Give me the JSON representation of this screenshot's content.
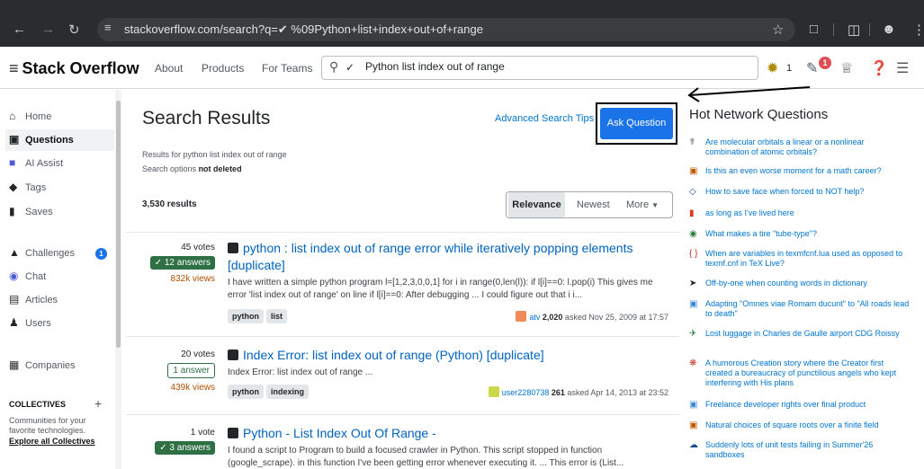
{
  "browser": {
    "url": "stackoverflow.com/search?q=✔ %09Python+list+index+out+of+range"
  },
  "topbar": {
    "logo": "Stack Overflow",
    "nav": [
      "About",
      "Products",
      "For Teams"
    ],
    "search_value": "Python list index out of range",
    "reputation": "1",
    "inbox_badge": "1"
  },
  "sidebar": {
    "items": [
      {
        "label": "Home",
        "icon": "home-icon"
      },
      {
        "label": "Questions",
        "icon": "questions-icon"
      },
      {
        "label": "AI Assist",
        "icon": "ai-assist-icon"
      },
      {
        "label": "Tags",
        "icon": "tag-icon"
      },
      {
        "label": "Saves",
        "icon": "bookmark-icon"
      },
      {
        "label": "Challenges",
        "icon": "challenges-icon"
      },
      {
        "label": "Chat",
        "icon": "chat-icon"
      },
      {
        "label": "Articles",
        "icon": "articles-icon"
      },
      {
        "label": "Users",
        "icon": "users-icon"
      },
      {
        "label": "Companies",
        "icon": "companies-icon"
      }
    ],
    "challenges_badge": "1",
    "collectives_title": "COLLECTIVES",
    "collectives_desc": "Communities for your favorite technologies.",
    "collectives_link": "Explore all Collectives"
  },
  "main": {
    "title": "Search Results",
    "advanced_tips": "Advanced Search Tips",
    "ask_button": "Ask Question",
    "results_for": "Results for python list index out of range",
    "search_options_label": "Search options",
    "search_options_value": "not deleted",
    "results_count": "3,530 results",
    "filters": {
      "relevance": "Relevance",
      "newest": "Newest",
      "more": "More"
    },
    "questions": [
      {
        "votes": "45 votes",
        "answers": "✓ 12 answers",
        "views": "832k views",
        "title": "python : list index out of range error while iteratively popping elements [duplicate]",
        "excerpt": "I have written a simple python program l=[1,2,3,0,0,1] for i in range(0,len(l)): if l[i]==0: l.pop(i) This gives me error 'list index out of range' on line if l[i]==0: After debugging ... I could figure out that i i...",
        "tags": [
          "python",
          "list"
        ],
        "user": "atv",
        "rep": "2,020",
        "asked": "asked Nov 25, 2009 at 17:57"
      },
      {
        "votes": "20 votes",
        "answers": "1 answer",
        "views": "439k views",
        "title": "Index Error: list index out of range (Python) [duplicate]",
        "excerpt": "Index Error: list index out of range ...",
        "tags": [
          "python",
          "indexing"
        ],
        "user": "user2280738",
        "rep": "261",
        "asked": "asked Apr 14, 2013 at 23:52"
      },
      {
        "votes": "1 vote",
        "answers": "✓ 3 answers",
        "views": "",
        "title": "Python - List Index Out Of Range -",
        "excerpt": "I found a script to Program to build a focused crawler in Python. This script stopped in function (google_scrape). in this function I've been getting error whenever executing it. ... This error is (List..."
      }
    ]
  },
  "hot_network": {
    "title": "Hot Network Questions",
    "items": [
      "Are molecular orbitals a linear or a nonlinear combination of atomic orbitals?",
      "Is this an even worse moment for a math career?",
      "How to save face when forced to NOT help?",
      "as long as I've lived here",
      "What makes a tire \"tube-type\"?",
      "When are variables in texmfcnf.lua used as opposed to texmf.cnf in TeX Live?",
      "Off-by-one when counting words in dictionary",
      "Adapting \"Omnes viae Romam ducunt\" to \"All roads lead to death\"",
      "Lost luggage in Charles de Gaulle airport CDG Roissy",
      "A humorous Creation story where the Creator first created a bureaucracy of punctilious angels who kept interfering with His plans",
      "Freelance developer rights over final product",
      "Natural choices of square roots over a finite field",
      "Suddenly lots of unit tests failing in Summer'26 sandboxes"
    ]
  }
}
